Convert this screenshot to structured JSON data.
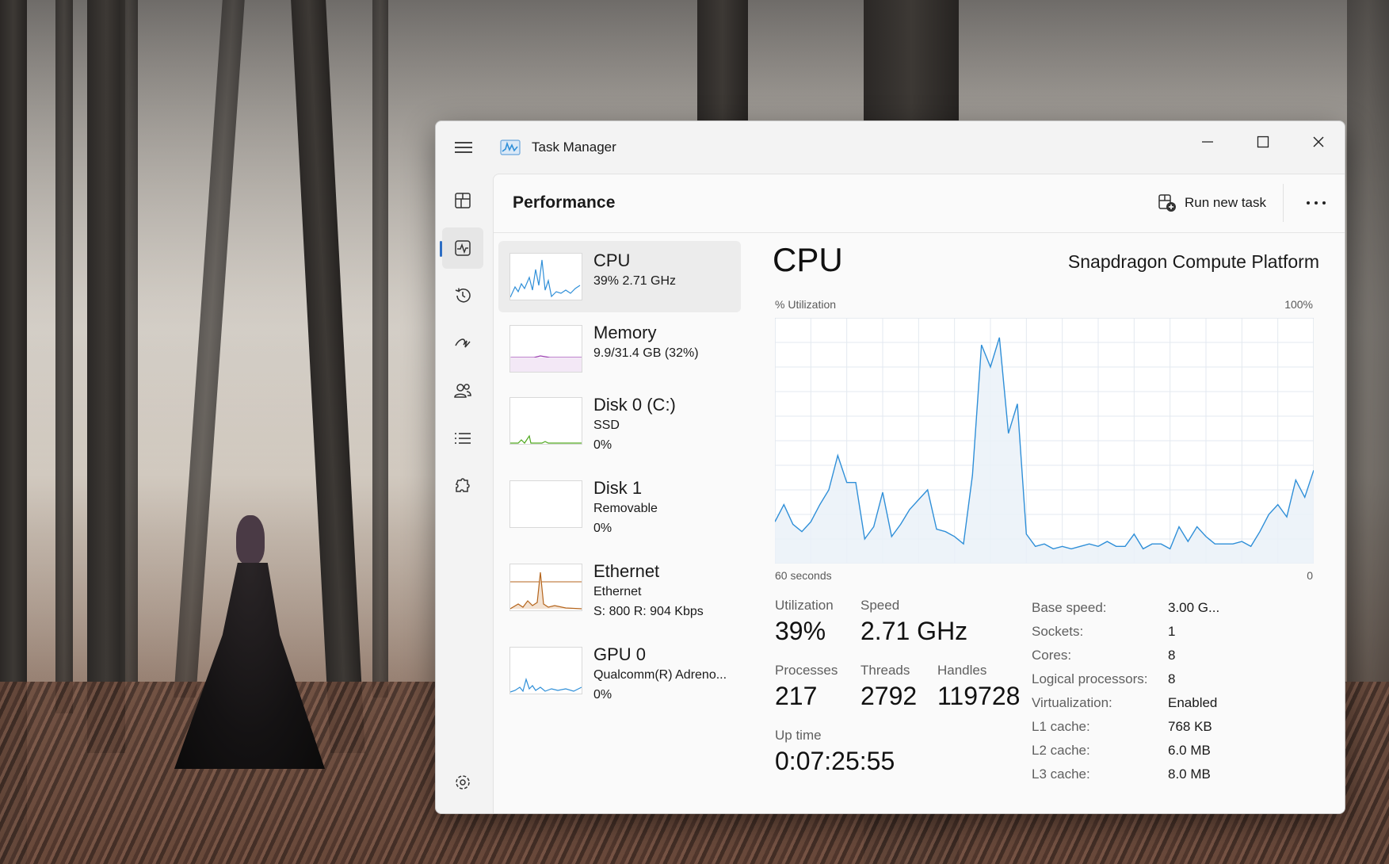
{
  "app": {
    "title": "Task Manager"
  },
  "window_controls": {
    "minimize": "minimize",
    "maximize": "maximize",
    "close": "close"
  },
  "nav": {
    "items": [
      {
        "name": "processes-icon"
      },
      {
        "name": "performance-icon"
      },
      {
        "name": "app-history-icon"
      },
      {
        "name": "startup-apps-icon"
      },
      {
        "name": "users-icon"
      },
      {
        "name": "details-icon"
      },
      {
        "name": "services-icon"
      }
    ],
    "settings": "settings-icon"
  },
  "page": {
    "title": "Performance"
  },
  "toolbar": {
    "run_new_task": "Run new task"
  },
  "resources": [
    {
      "name": "CPU",
      "line1": "39%  2.71 GHz",
      "line2": "",
      "color": "#2f8fd8"
    },
    {
      "name": "Memory",
      "line1": "9.9/31.4 GB (32%)",
      "line2": "",
      "color": "#9b3fb0"
    },
    {
      "name": "Disk 0 (C:)",
      "line1": "SSD",
      "line2": "0%",
      "color": "#4fa81f"
    },
    {
      "name": "Disk 1",
      "line1": "Removable",
      "line2": "0%",
      "color": "#4fa81f"
    },
    {
      "name": "Ethernet",
      "line1": "Ethernet",
      "line2": "S: 800  R: 904 Kbps",
      "color": "#b5651d"
    },
    {
      "name": "GPU 0",
      "line1": "Qualcomm(R) Adreno...",
      "line2": "0%",
      "color": "#2f8fd8"
    }
  ],
  "detail": {
    "title": "CPU",
    "model": "Snapdragon Compute Platform",
    "y_label": "% Utilization",
    "y_max_label": "100%",
    "x_left_label": "60 seconds",
    "x_right_label": "0",
    "stats": {
      "utilization_label": "Utilization",
      "utilization": "39%",
      "speed_label": "Speed",
      "speed": "2.71 GHz",
      "processes_label": "Processes",
      "processes": "217",
      "threads_label": "Threads",
      "threads": "2792",
      "handles_label": "Handles",
      "handles": "119728",
      "uptime_label": "Up time",
      "uptime": "0:07:25:55"
    },
    "specs": [
      {
        "k": "Base speed:",
        "v": "3.00 G..."
      },
      {
        "k": "Sockets:",
        "v": "1"
      },
      {
        "k": "Cores:",
        "v": "8"
      },
      {
        "k": "Logical processors:",
        "v": "8"
      },
      {
        "k": "Virtualization:",
        "v": "Enabled"
      },
      {
        "k": "L1 cache:",
        "v": "768 KB"
      },
      {
        "k": "L2 cache:",
        "v": "6.0 MB"
      },
      {
        "k": "L3 cache:",
        "v": "8.0 MB"
      }
    ]
  },
  "chart_data": {
    "type": "area",
    "ylim": [
      0,
      100
    ],
    "grid": true,
    "color": "#2f8fd8",
    "fill": "#eaf1f8",
    "values": [
      17,
      24,
      16,
      13,
      17,
      24,
      30,
      44,
      33,
      33,
      10,
      15,
      29,
      11,
      16,
      22,
      26,
      30,
      14,
      13,
      11,
      8,
      36,
      89,
      80,
      92,
      53,
      65,
      12,
      7,
      8,
      6,
      7,
      6,
      7,
      8,
      7,
      9,
      7,
      7,
      12,
      6,
      8,
      8,
      6,
      15,
      9,
      15,
      11,
      8,
      8,
      8,
      9,
      7,
      13,
      20,
      24,
      19,
      34,
      27,
      38
    ]
  }
}
